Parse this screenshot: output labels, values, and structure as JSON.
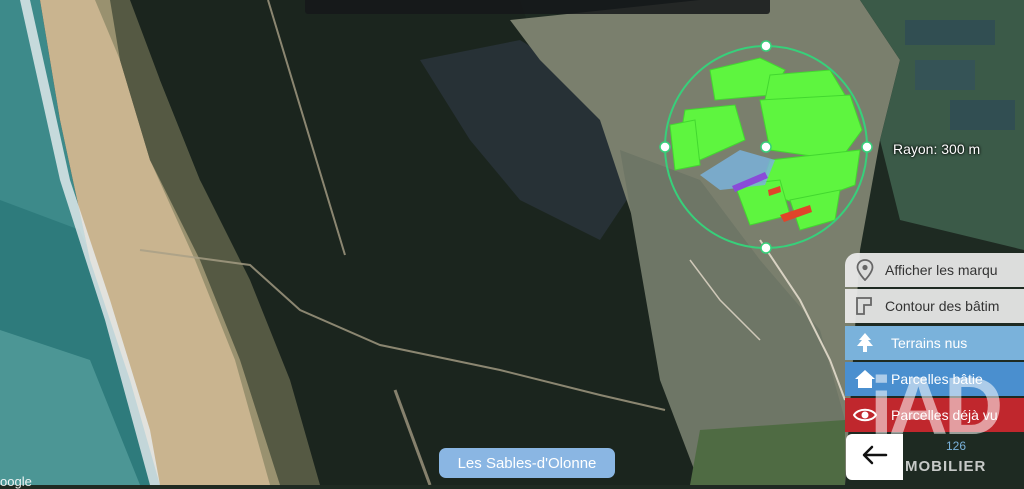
{
  "map": {
    "place": "Les Sables-d'Olonne",
    "radius_label": "Rayon: 300 m",
    "attribution": "oogle",
    "colors": {
      "circle": "#37d07a",
      "parcel_built": "#5cff3c",
      "parcel_bare": "#7ab2db",
      "parcel_seen": "#e0442a",
      "selection": "#8a4bd8"
    }
  },
  "panel": {
    "markers_label": "Afficher les marqu",
    "markers_icon": "map-pin-icon",
    "contour_label": "Contour des bâtim",
    "contour_icon": "building-outline-icon",
    "terrains_label": "Terrains nus",
    "terrains_icon": "tree-icon",
    "bati_label": "Parcelles bâtie",
    "bati_icon": "house-icon",
    "vues_label": "Parcelles déjà vu",
    "vues_icon": "eye-icon",
    "back_icon": "arrow-left-icon",
    "count": "126",
    "colors": {
      "terrains": "#7ab2db",
      "bati": "#4a8fcf",
      "vues": "#c0272d"
    }
  },
  "brand": {
    "watermark_big": "iAD",
    "watermark_small": "MOBILIER"
  }
}
